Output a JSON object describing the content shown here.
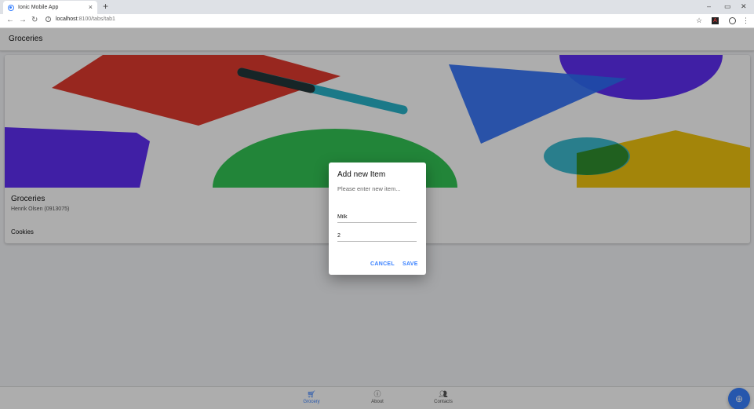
{
  "browser": {
    "tab_title": "Ionic Mobile App",
    "tab_close": "×",
    "new_tab": "+",
    "url_host": "localhost",
    "url_path": ":8100/tabs/tab1",
    "min": "–",
    "max": "▭",
    "close": "✕"
  },
  "header": {
    "title": "Groceries"
  },
  "card": {
    "title": "Groceries",
    "subtitle": "Henrik Olsen (0913075)",
    "items": [
      "Cookies"
    ]
  },
  "tabs": [
    {
      "label": "Grocery",
      "icon": "cart-icon"
    },
    {
      "label": "About",
      "icon": "info-icon"
    },
    {
      "label": "Contacts",
      "icon": "people-icon"
    }
  ],
  "fab": {
    "icon": "plus-icon"
  },
  "alert": {
    "title": "Add new Item",
    "message": "Please enter new item...",
    "name_value": "Milk",
    "quantity_value": "2",
    "cancel_label": "CANCEL",
    "save_label": "SAVE"
  },
  "colors": {
    "accent": "#3880ff",
    "shape_red": "#e03a2e",
    "shape_teal": "#28b3c9",
    "shape_blue": "#2d6ff7",
    "shape_purple": "#5f2ff3",
    "shape_green": "#33c455",
    "shape_yellow": "#f1c40f"
  }
}
